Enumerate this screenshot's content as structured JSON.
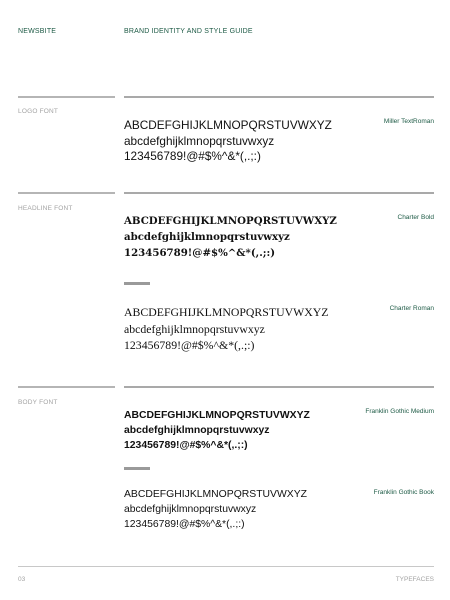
{
  "header": {
    "brand": "NEWSBITE",
    "title": "BRAND IDENTITY AND STYLE GUIDE"
  },
  "sections": {
    "logo": {
      "label": "LOGO FONT",
      "font_name": "Miller TextRoman",
      "lines": [
        "ABCDEFGHIJKLMNOPQRSTUVWXYZ",
        "abcdefghijklmnopqrstuvwxyz",
        "123456789!@#$%^&*(,.;:)"
      ]
    },
    "headline": {
      "label": "HEADLINE FONT",
      "bold": {
        "font_name": "Charter Bold",
        "lines": [
          "ABCDEFGHIJKLMNOPQRSTUVWXYZ",
          "abcdefghijklmnopqrstuvwxyz",
          "123456789!@#$%^&*(,.;:)"
        ]
      },
      "roman": {
        "font_name": "Charter Roman",
        "lines": [
          "ABCDEFGHIJKLMNOPQRSTUVWXYZ",
          "abcdefghijklmnopqrstuvwxyz",
          "123456789!@#$%^&*(,.;:)"
        ]
      }
    },
    "body": {
      "label": "BODY FONT",
      "medium": {
        "font_name": "Franklin Gothic Medium",
        "lines": [
          "ABCDEFGHIJKLMNOPQRSTUVWXYZ",
          "abcdefghijklmnopqrstuvwxyz",
          "123456789!@#$%^&*(,.;:)"
        ]
      },
      "book": {
        "font_name": "Franklin Gothic Book",
        "lines": [
          "ABCDEFGHIJKLMNOPQRSTUVWXYZ",
          "abcdefghijklmnopqrstuvwxyz",
          "123456789!@#$%^&*(,.;:)"
        ]
      }
    }
  },
  "footer": {
    "page_number": "03",
    "section": "TYPEFACES"
  },
  "colors": {
    "accent": "#1d5a45",
    "muted": "#a3a3a3"
  }
}
